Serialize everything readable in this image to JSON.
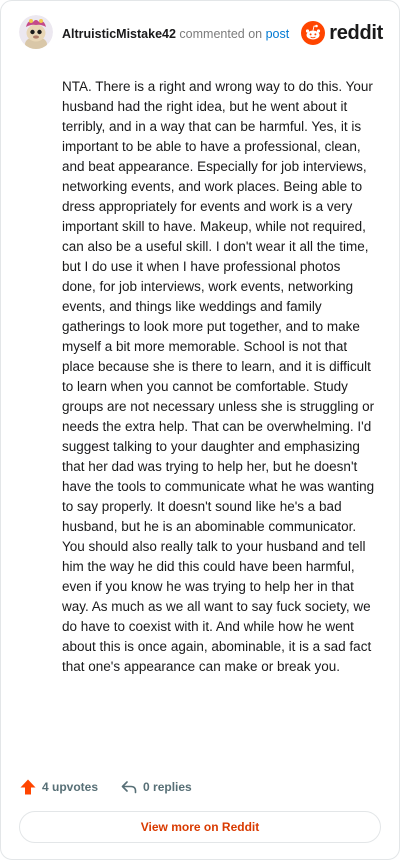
{
  "comment": {
    "username": "AltruisticMistake42",
    "action_text": "commented on",
    "target_link": "post",
    "body": "NTA. There is a right and wrong way to do this. Your husband had the right idea, but he went about it terribly, and in a way that can be harmful. Yes, it is important to be able to have a professional, clean, and beat appearance. Especially for job interviews, networking events, and work places. Being able to dress appropriately for events and work is a very important skill to have. Makeup, while not required, can also be a useful skill. I don't wear it all the time, but I do use it when I have professional photos done, for job interviews, work events, networking events, and things like weddings and family gatherings to look more put together, and to make myself a bit more memorable. School is not that place because she is there to learn, and it is difficult to learn when you cannot be comfortable. Study groups are not necessary unless she is struggling or needs the extra help. That can be overwhelming. I'd suggest talking to your daughter and emphasizing that her dad was trying to help her, but he doesn't have the tools to communicate what he was wanting to say properly. It doesn't sound like he's a bad husband, but he is an abominable communicator. You should also really talk to your husband and tell him the way he did this could have been harmful, even if you know he was trying to help her in that way. As much as we all want to say fuck society, we do have to coexist with it. And while how he went about this is once again, abominable, it is a sad fact that one's appearance can make or break you.",
    "upvotes_label": "4 upvotes",
    "replies_label": "0 replies"
  },
  "brand": {
    "name": "reddit",
    "color": "#ff4500",
    "icon": "reddit-logo-icon"
  },
  "footer": {
    "view_more_label": "View more on Reddit"
  },
  "colors": {
    "accent_link": "#0079d3",
    "upvote": "#ff4500",
    "view_more_text": "#d93a00",
    "muted": "#576f76"
  }
}
